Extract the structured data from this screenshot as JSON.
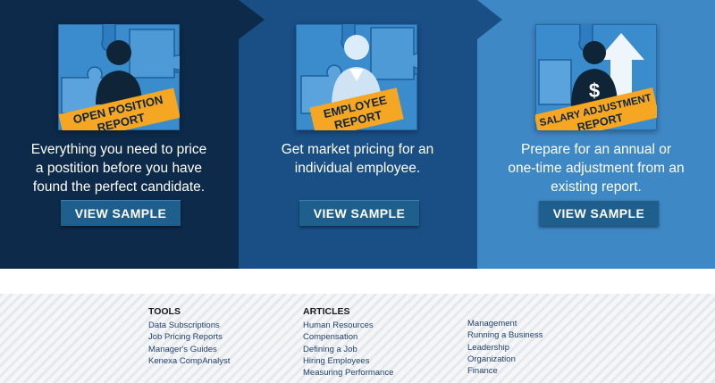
{
  "colors": {
    "panel_1": "#0d2a4a",
    "panel_2": "#1a4f86",
    "panel_3": "#3f88c6",
    "button": "#1f5f8e",
    "badge": "#f5a623",
    "footer_link": "#24426e"
  },
  "hero": {
    "panels": [
      {
        "badge_lines": [
          "OPEN POSITION",
          "REPORT"
        ],
        "description_lines": [
          "Everything you need to price",
          "a postition before you have",
          "found the perfect candidate."
        ],
        "button_label": "VIEW SAMPLE"
      },
      {
        "badge_lines": [
          "EMPLOYEE",
          "REPORT"
        ],
        "description_lines": [
          "Get market pricing for an",
          "individual employee."
        ],
        "button_label": "VIEW SAMPLE"
      },
      {
        "badge_lines": [
          "SALARY ADJUSTMENT",
          "REPORT"
        ],
        "description_lines": [
          "Prepare for an annual or",
          "one-time adjustment from an",
          "existing report."
        ],
        "button_label": "VIEW SAMPLE"
      }
    ]
  },
  "footer": {
    "tools": {
      "heading": "TOOLS",
      "links": [
        "Data Subscriptions",
        "Job Pricing Reports",
        "Manager's Guides",
        "Kenexa CompAnalyst"
      ]
    },
    "articles": {
      "heading": "ARTICLES",
      "links": [
        "Human Resources",
        "Compensation",
        "Defining a Job",
        "Hiring Employees",
        "Measuring Performance"
      ]
    },
    "more": {
      "links": [
        "Management",
        "Running a Business",
        "Leadership",
        "Organization",
        "Finance"
      ]
    }
  }
}
